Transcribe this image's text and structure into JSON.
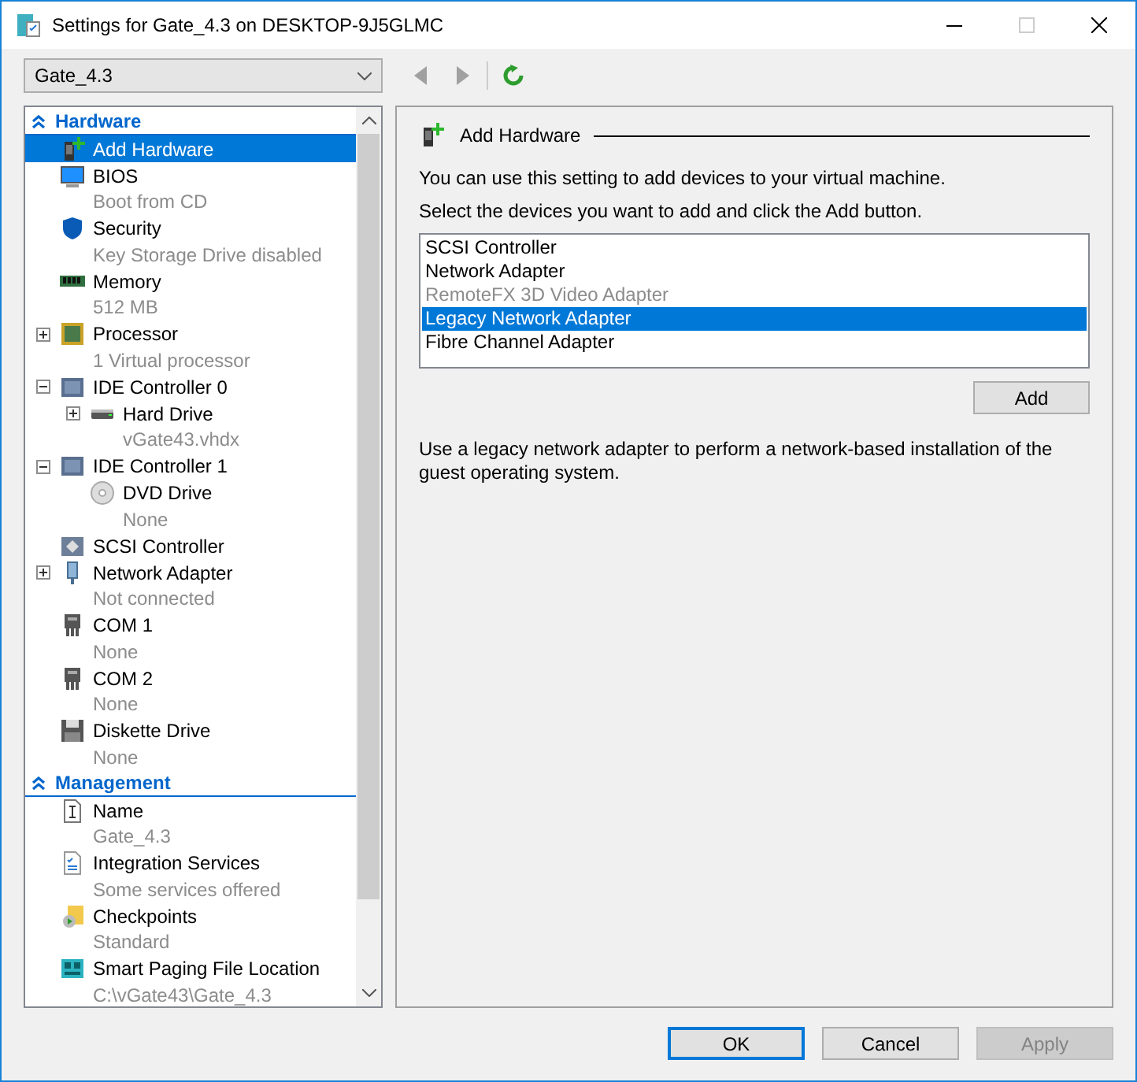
{
  "window": {
    "title": "Settings for Gate_4.3 on DESKTOP-9J5GLMC"
  },
  "vm_selector": {
    "value": "Gate_4.3"
  },
  "nav_buttons": [
    {
      "kind": "back",
      "disabled": true
    },
    {
      "kind": "forward",
      "disabled": true
    },
    {
      "kind": "refresh",
      "disabled": false
    }
  ],
  "tree": [
    {
      "label": "Hardware",
      "expanded": true,
      "items": [
        {
          "kind": "add-hardware",
          "label": "Add Hardware",
          "selected": true
        },
        {
          "kind": "bios",
          "label": "BIOS",
          "detail": "Boot from CD",
          "selected": false
        },
        {
          "kind": "security",
          "label": "Security",
          "detail": "Key Storage Drive disabled",
          "selected": false
        },
        {
          "kind": "memory",
          "label": "Memory",
          "detail": "512 MB",
          "selected": false
        },
        {
          "kind": "processor",
          "label": "Processor",
          "detail": "1 Virtual processor",
          "expanded": false,
          "selected": false
        },
        {
          "kind": "controller",
          "label": "IDE Controller 0",
          "expanded": true,
          "selected": false,
          "children": [
            {
              "kind": "disk",
              "label": "Hard Drive",
              "detail": "vGate43.vhdx",
              "expanded": false,
              "selected": false
            }
          ]
        },
        {
          "kind": "controller",
          "label": "IDE Controller 1",
          "expanded": true,
          "selected": false,
          "children": [
            {
              "kind": "dvd",
              "label": "DVD Drive",
              "detail": "None",
              "selected": false
            }
          ]
        },
        {
          "kind": "scsi",
          "label": "SCSI Controller",
          "selected": false
        },
        {
          "kind": "network",
          "label": "Network Adapter",
          "detail": "Not connected",
          "expanded": false,
          "selected": false
        },
        {
          "kind": "com",
          "label": "COM 1",
          "detail": "None",
          "selected": false
        },
        {
          "kind": "com",
          "label": "COM 2",
          "detail": "None",
          "selected": false
        },
        {
          "kind": "diskette",
          "label": "Diskette Drive",
          "detail": "None",
          "selected": false
        }
      ]
    },
    {
      "label": "Management",
      "expanded": true,
      "items": [
        {
          "kind": "name",
          "label": "Name",
          "detail": "Gate_4.3",
          "selected": false
        },
        {
          "kind": "integration",
          "label": "Integration Services",
          "detail": "Some services offered",
          "selected": false
        },
        {
          "kind": "checkpoints",
          "label": "Checkpoints",
          "detail": "Standard",
          "selected": false
        },
        {
          "kind": "paging",
          "label": "Smart Paging File Location",
          "detail": "C:\\vGate43\\Gate_4.3",
          "selected": false
        }
      ]
    }
  ],
  "settings": {
    "title": "Add Hardware",
    "intro": "You can use this setting to add devices to your virtual machine.",
    "prompt": "Select the devices you want to add and click the Add button.",
    "devices": [
      {
        "label": "SCSI Controller",
        "selected": false,
        "disabled": false
      },
      {
        "label": "Network Adapter",
        "selected": false,
        "disabled": false
      },
      {
        "label": "RemoteFX 3D Video Adapter",
        "selected": false,
        "disabled": true
      },
      {
        "label": "Legacy Network Adapter",
        "selected": true,
        "disabled": false
      },
      {
        "label": "Fibre Channel Adapter",
        "selected": false,
        "disabled": false
      }
    ],
    "add_button": "Add",
    "description": "Use a legacy network adapter to perform a network-based installation of the guest operating system."
  },
  "buttons": [
    {
      "label": "OK",
      "default": true,
      "disabled": false
    },
    {
      "label": "Cancel",
      "default": false,
      "disabled": false
    },
    {
      "label": "Apply",
      "default": false,
      "disabled": true
    }
  ]
}
